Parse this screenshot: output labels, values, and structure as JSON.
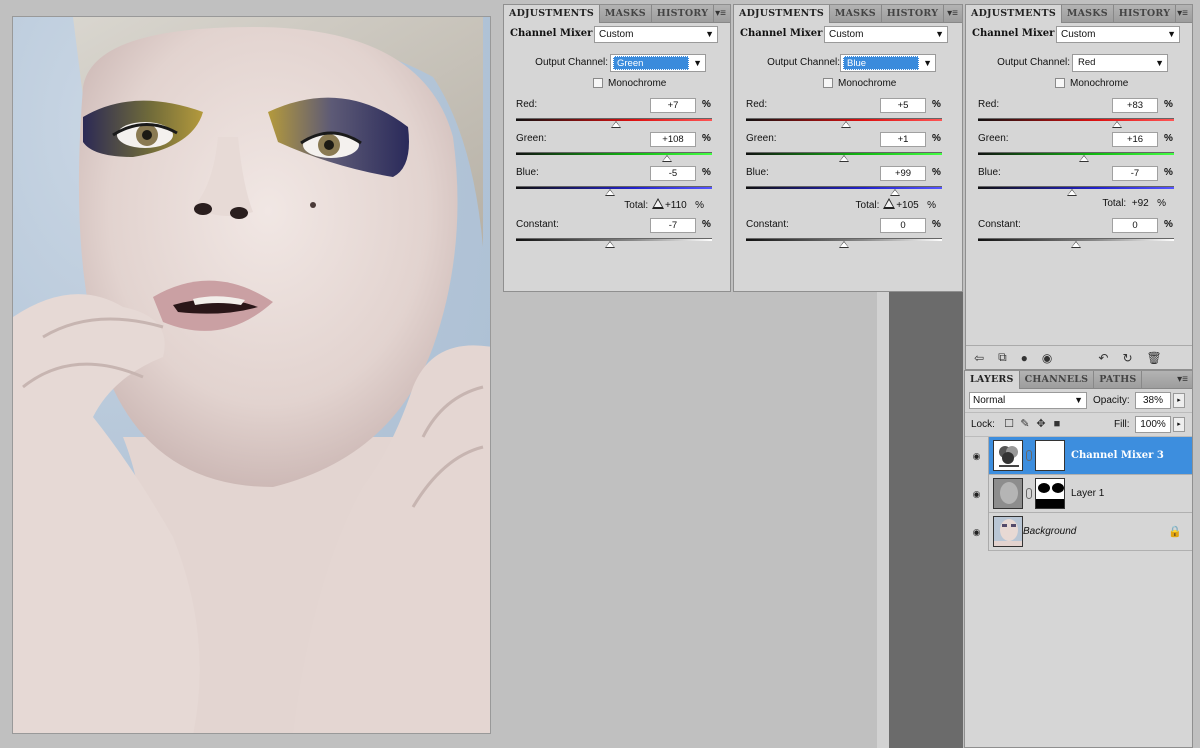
{
  "tabs": {
    "adjustments": "ADJUSTMENTS",
    "masks": "MASKS",
    "history": "HISTORY",
    "layers": "LAYERS",
    "channels": "CHANNELS",
    "paths": "PATHS"
  },
  "labels": {
    "adj_name": "Channel Mixer",
    "output_channel": "Output Channel:",
    "monochrome": "Monochrome",
    "red": "Red:",
    "green": "Green:",
    "blue": "Blue:",
    "constant": "Constant:",
    "total": "Total:",
    "pct": "%"
  },
  "panels": [
    {
      "preset": "Custom",
      "output": "Green",
      "red": "+7",
      "green": "+108",
      "blue": "-5",
      "total": "+110",
      "constant": "-7",
      "warning": true,
      "levels": {
        "red": 0.51,
        "green": 0.77,
        "blue": 0.48,
        "constant": 0.48
      }
    },
    {
      "preset": "Custom",
      "output": "Blue",
      "red": "+5",
      "green": "+1",
      "blue": "+99",
      "total": "+105",
      "constant": "0",
      "warning": true,
      "levels": {
        "red": 0.51,
        "green": 0.5,
        "blue": 0.76,
        "constant": 0.5
      }
    },
    {
      "preset": "Custom",
      "output": "Red",
      "red": "+83",
      "green": "+16",
      "blue": "-7",
      "total": "+92",
      "constant": "0",
      "warning": false,
      "levels": {
        "red": 0.71,
        "green": 0.54,
        "blue": 0.48,
        "constant": 0.5
      }
    }
  ],
  "layers_panel": {
    "blend_mode": "Normal",
    "opacity_label": "Opacity:",
    "opacity": "38%",
    "lock_label": "Lock:",
    "fill_label": "Fill:",
    "fill": "100%",
    "layers": [
      {
        "name": "Channel Mixer 3",
        "selected": true
      },
      {
        "name": "Layer 1",
        "selected": false
      },
      {
        "name": "Background",
        "selected": false
      }
    ]
  },
  "colors": {
    "selection": "#3d8ede",
    "panel": "#d6d6d6"
  }
}
